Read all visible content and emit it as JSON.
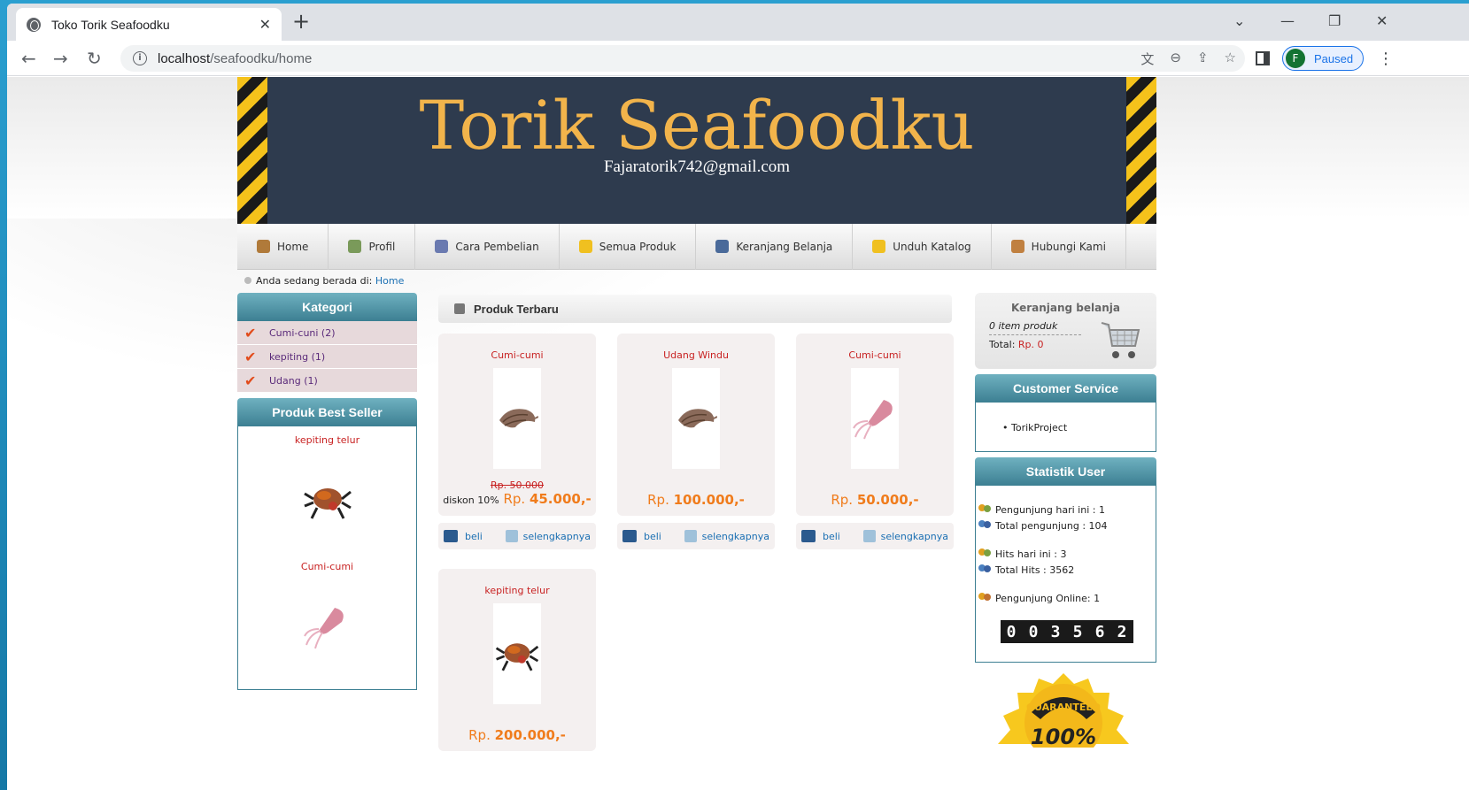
{
  "browser": {
    "tab_title": "Toko Torik Seafoodku",
    "tab_close": "✕",
    "new_tab": "+",
    "url_host": "localhost",
    "url_path": "/seafoodku/home",
    "profile_initial": "F",
    "profile_status": "Paused"
  },
  "header": {
    "title": "Torik Seafoodku",
    "email": "Fajaratorik742@gmail.com"
  },
  "menu": [
    {
      "label": "Home",
      "color": "#b07a3a"
    },
    {
      "label": "Profil",
      "color": "#7a9a5a"
    },
    {
      "label": "Cara Pembelian",
      "color": "#6a7ab0"
    },
    {
      "label": "Semua Produk",
      "color": "#f0c020"
    },
    {
      "label": "Keranjang Belanja",
      "color": "#4a6a9a"
    },
    {
      "label": "Unduh Katalog",
      "color": "#f0c020"
    },
    {
      "label": "Hubungi Kami",
      "color": "#c08040"
    }
  ],
  "breadcrumb": {
    "text": "Anda sedang berada di:",
    "link": "Home"
  },
  "kategori": {
    "title": "Kategori",
    "items": [
      "Cumi-cuni (2)",
      "kepiting (1)",
      "Udang (1)"
    ]
  },
  "best_seller": {
    "title": "Produk Best Seller",
    "items": [
      "kepiting telur",
      "Cumi-cumi"
    ]
  },
  "produk_terbaru": {
    "title": "Produk Terbaru",
    "buy_label": "beli",
    "more_label": "selengkapnya",
    "items": [
      {
        "name": "Cumi-cumi",
        "old_price": "Rp. 50.000",
        "discount": "diskon 10%",
        "currency": "Rp.",
        "price": "45.000,-",
        "image": "shrimp"
      },
      {
        "name": "Udang Windu",
        "currency": "Rp.",
        "price": "100.000,-",
        "image": "shrimp"
      },
      {
        "name": "Cumi-cumi",
        "currency": "Rp.",
        "price": "50.000,-",
        "image": "squid"
      },
      {
        "name": "kepiting telur",
        "currency": "Rp.",
        "price": "200.000,-",
        "image": "crab"
      }
    ]
  },
  "cart": {
    "title": "Keranjang belanja",
    "items_text": "0 item produk",
    "total_label": "Total:",
    "total_value": "Rp. 0"
  },
  "customer_service": {
    "title": "Customer Service",
    "item": "• TorikProject"
  },
  "statistik": {
    "title": "Statistik User",
    "lines": [
      "Pengunjung hari ini : 1",
      "Total pengunjung : 104",
      "Hits hari ini : 3",
      "Total Hits : 3562",
      "Pengunjung Online: 1"
    ],
    "counter": [
      "0",
      "0",
      "3",
      "5",
      "6",
      "2"
    ]
  },
  "badge": {
    "top": "GUARANTEED",
    "bottom": "100%"
  }
}
